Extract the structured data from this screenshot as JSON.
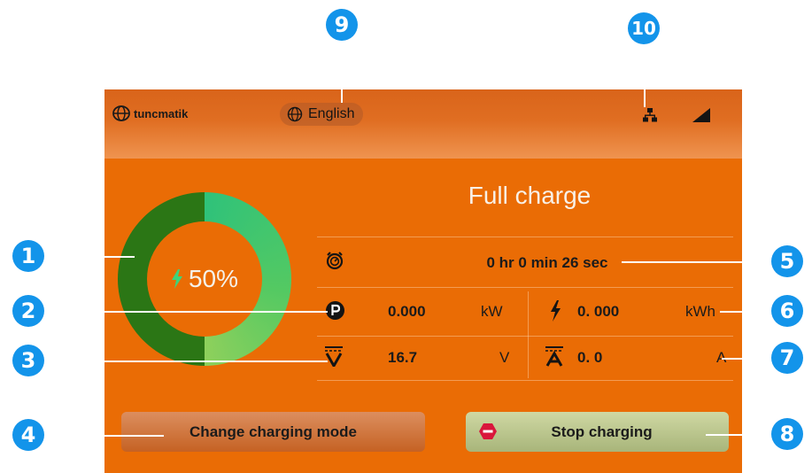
{
  "header": {
    "brand": "tuncmatik",
    "language": "English"
  },
  "charge": {
    "percent": "50%",
    "percent_value": 50,
    "mode_title": "Full charge",
    "elapsed": "0 hr 0 min 26 sec"
  },
  "metrics": {
    "power_value": "0.000",
    "power_unit": "kW",
    "energy_value": "0. 000",
    "energy_unit": "kWh",
    "voltage_value": "16.7",
    "voltage_unit": "V",
    "current_value": "0. 0",
    "current_unit": "A"
  },
  "buttons": {
    "change_mode": "Change charging mode",
    "stop": "Stop charging"
  },
  "callouts": [
    "1",
    "2",
    "3",
    "4",
    "5",
    "6",
    "7",
    "8",
    "9",
    "10"
  ],
  "colors": {
    "screen_bg": "#ea6c05",
    "ring_fill": "#54c962",
    "ring_track": "#2b7615",
    "callout": "#1394ea",
    "stop_icon": "#d9163b"
  }
}
